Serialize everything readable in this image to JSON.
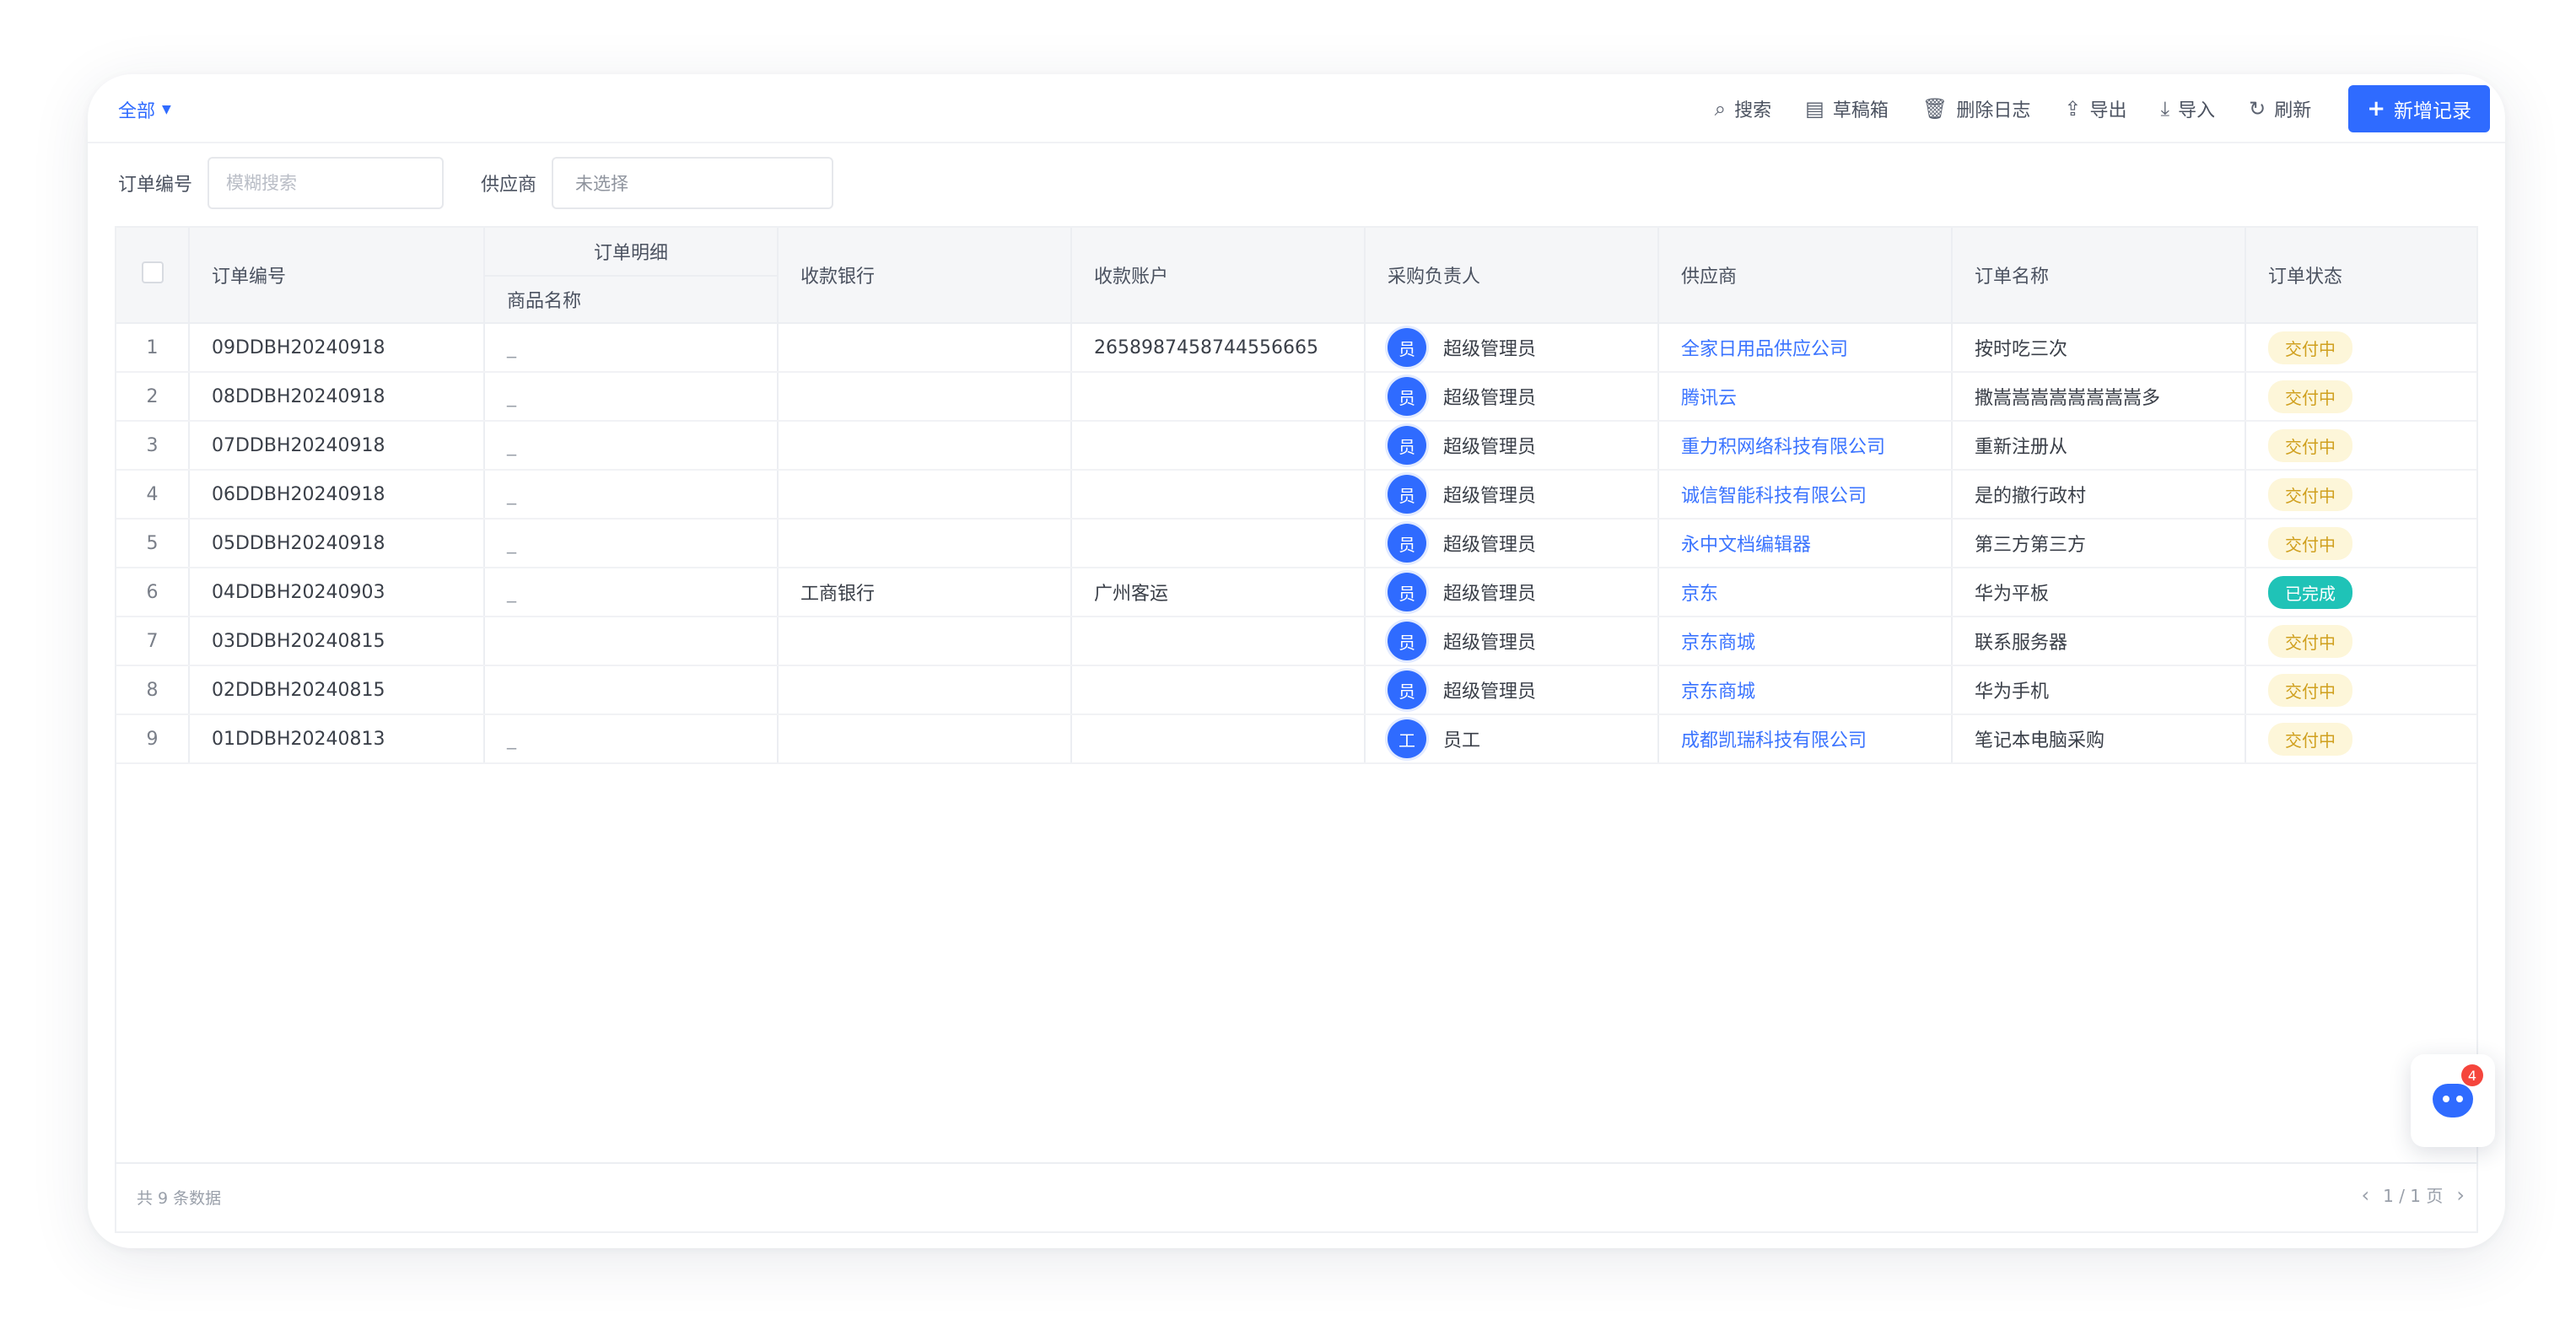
{
  "toolbar": {
    "view_label": "全部",
    "search_label": "搜索",
    "drafts_label": "草稿箱",
    "delete_log_label": "删除日志",
    "export_label": "导出",
    "import_label": "导入",
    "refresh_label": "刷新",
    "add_label": "新增记录"
  },
  "filters": {
    "order_no_label": "订单编号",
    "order_no_placeholder": "模糊搜索",
    "supplier_label": "供应商",
    "supplier_value": "未选择"
  },
  "table": {
    "headers": {
      "order_no": "订单编号",
      "order_detail": "订单明细",
      "product_name": "商品名称",
      "bank": "收款银行",
      "account": "收款账户",
      "buyer": "采购负责人",
      "supplier": "供应商",
      "order_name": "订单名称",
      "status": "订单状态"
    },
    "rows": [
      {
        "idx": "1",
        "order_no": "09DDBH20240918",
        "product": "_",
        "bank": "",
        "account": "2658987458744556665",
        "avatar": "员",
        "buyer": "超级管理员",
        "supplier": "全家日用品供应公司",
        "order_name": "按时吃三次",
        "status": "交付中"
      },
      {
        "idx": "2",
        "order_no": "08DDBH20240918",
        "product": "_",
        "bank": "",
        "account": "",
        "avatar": "员",
        "buyer": "超级管理员",
        "supplier": "腾讯云",
        "order_name": "撒嵩嵩嵩嵩嵩嵩嵩嵩多",
        "status": "交付中"
      },
      {
        "idx": "3",
        "order_no": "07DDBH20240918",
        "product": "_",
        "bank": "",
        "account": "",
        "avatar": "员",
        "buyer": "超级管理员",
        "supplier": "重力积网络科技有限公司",
        "order_name": "重新注册从",
        "status": "交付中"
      },
      {
        "idx": "4",
        "order_no": "06DDBH20240918",
        "product": "_",
        "bank": "",
        "account": "",
        "avatar": "员",
        "buyer": "超级管理员",
        "supplier": "诚信智能科技有限公司",
        "order_name": "是的撤行政村",
        "status": "交付中"
      },
      {
        "idx": "5",
        "order_no": "05DDBH20240918",
        "product": "_",
        "bank": "",
        "account": "",
        "avatar": "员",
        "buyer": "超级管理员",
        "supplier": "永中文档编辑器",
        "order_name": "第三方第三方",
        "status": "交付中"
      },
      {
        "idx": "6",
        "order_no": "04DDBH20240903",
        "product": "_",
        "bank": "工商银行",
        "account": "广州客运",
        "avatar": "员",
        "buyer": "超级管理员",
        "supplier": "京东",
        "order_name": "华为平板",
        "status": "已完成"
      },
      {
        "idx": "7",
        "order_no": "03DDBH20240815",
        "product": "",
        "bank": "",
        "account": "",
        "avatar": "员",
        "buyer": "超级管理员",
        "supplier": "京东商城",
        "order_name": "联系服务器",
        "status": "交付中"
      },
      {
        "idx": "8",
        "order_no": "02DDBH20240815",
        "product": "",
        "bank": "",
        "account": "",
        "avatar": "员",
        "buyer": "超级管理员",
        "supplier": "京东商城",
        "order_name": "华为手机",
        "status": "交付中"
      },
      {
        "idx": "9",
        "order_no": "01DDBH20240813",
        "product": "_",
        "bank": "",
        "account": "",
        "avatar": "工",
        "buyer": "员工",
        "supplier": "成都凯瑞科技有限公司",
        "order_name": "笔记本电脑采购",
        "status": "交付中"
      }
    ]
  },
  "footer": {
    "total_text": "共 9 条数据",
    "page_text": "1 / 1 页"
  },
  "float_help": {
    "badge_count": "4"
  },
  "colors": {
    "accent": "#2f6bff",
    "status_in_progress": "#d0a01f",
    "status_done": "#1fc3b7"
  }
}
